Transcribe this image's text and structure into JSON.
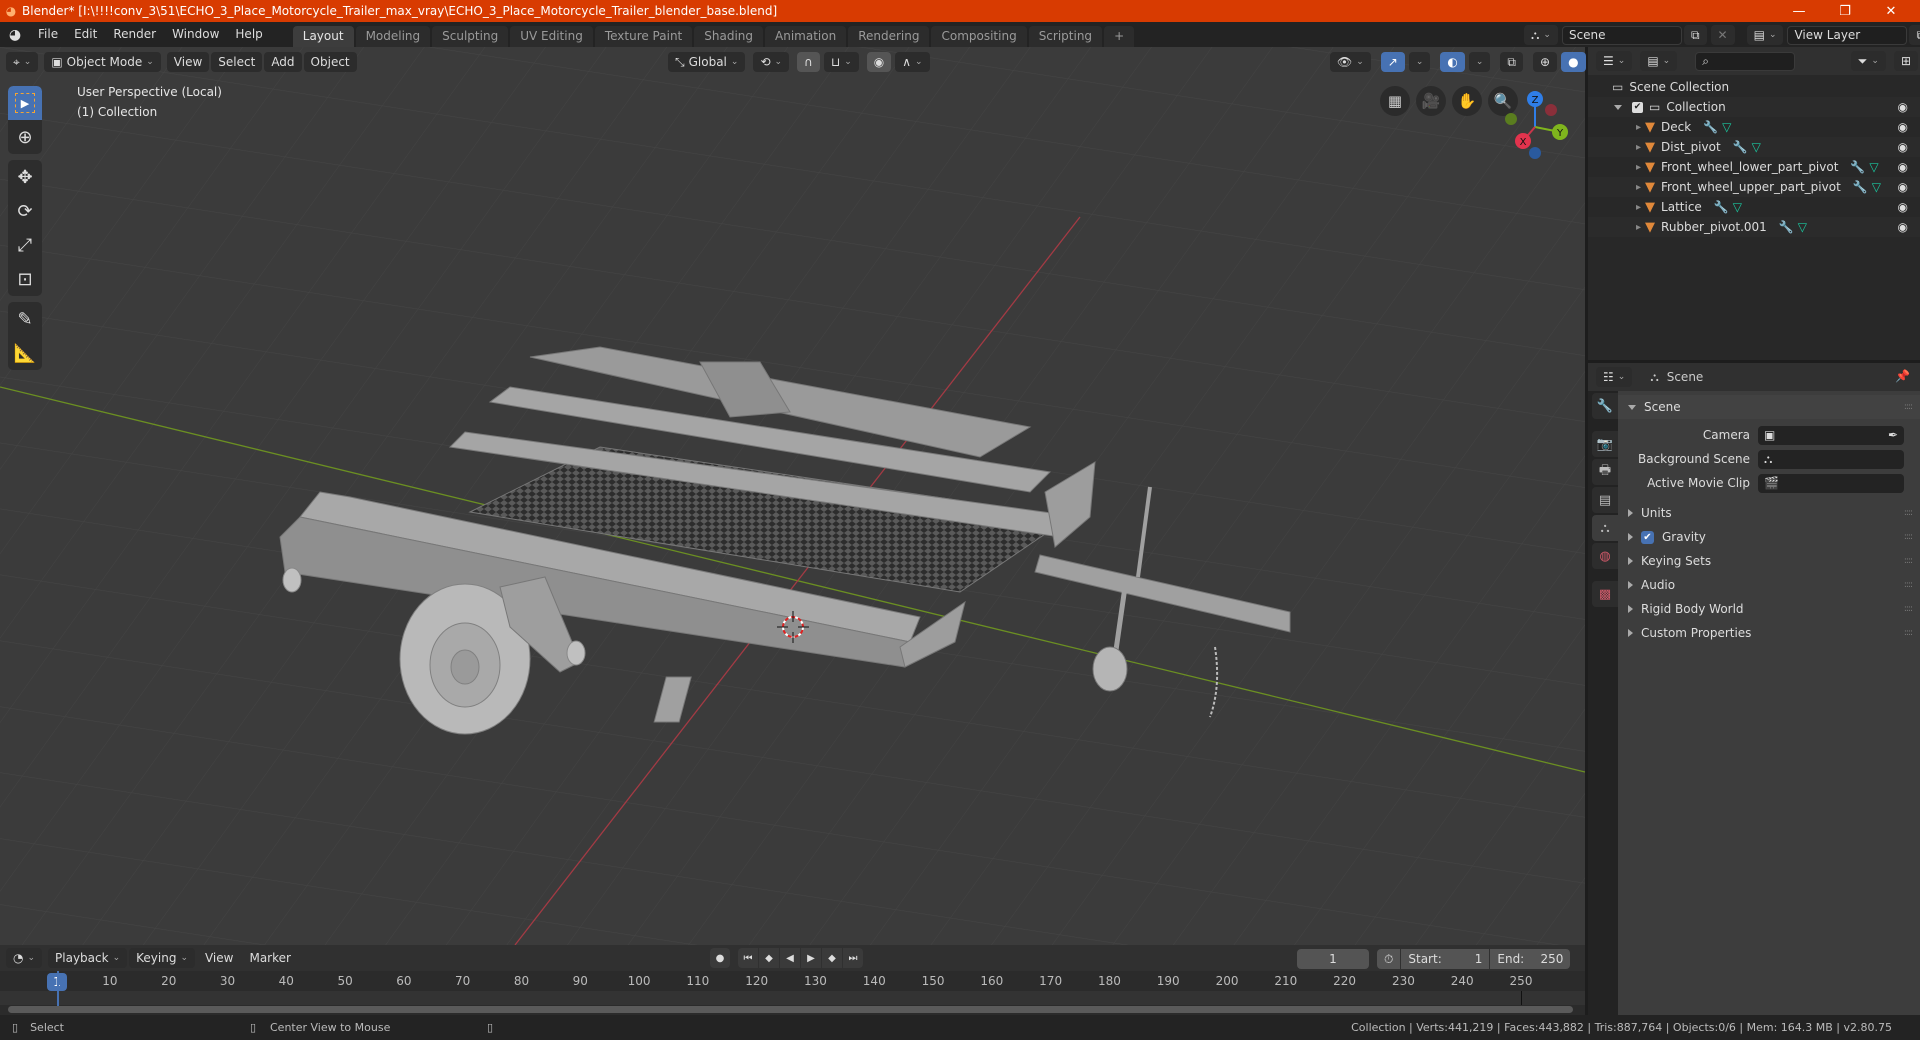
{
  "window": {
    "title": "Blender* [I:\\!!!!conv_3\\51\\ECHO_3_Place_Motorcycle_Trailer_max_vray\\ECHO_3_Place_Motorcycle_Trailer_blender_base.blend]",
    "controls": {
      "minimize": "—",
      "maximize": "❐",
      "close": "✕"
    }
  },
  "menubar": {
    "items": [
      "File",
      "Edit",
      "Render",
      "Window",
      "Help"
    ]
  },
  "workspaces": {
    "tabs": [
      "Layout",
      "Modeling",
      "Sculpting",
      "UV Editing",
      "Texture Paint",
      "Shading",
      "Animation",
      "Rendering",
      "Compositing",
      "Scripting"
    ],
    "active": "Layout",
    "add_label": "+"
  },
  "scene_selector": {
    "value": "Scene"
  },
  "view_layer_selector": {
    "value": "View Layer"
  },
  "viewport": {
    "mode": "Object Mode",
    "menus": [
      "View",
      "Select",
      "Add",
      "Object"
    ],
    "orientation": "Global",
    "overlay_text": {
      "view_name": "User Perspective (Local)",
      "collection": "(1) Collection"
    },
    "gizmo_axes": {
      "x": "X",
      "y": "Y",
      "z": "Z"
    },
    "colors": {
      "x_axis": "#c8364a",
      "y_axis": "#7fb51d",
      "z_axis": "#2f7ee8",
      "accent": "#4772b3"
    }
  },
  "tools": [
    "select-box",
    "cursor",
    "move",
    "rotate",
    "scale",
    "transform",
    "annotate",
    "measure"
  ],
  "outliner": {
    "search_placeholder": "",
    "root": "Scene Collection",
    "collection": "Collection",
    "objects": [
      {
        "name": "Deck"
      },
      {
        "name": "Dist_pivot"
      },
      {
        "name": "Front_wheel_lower_part_pivot"
      },
      {
        "name": "Front_wheel_upper_part_pivot"
      },
      {
        "name": "Lattice"
      },
      {
        "name": "Rubber_pivot.001"
      }
    ]
  },
  "properties": {
    "context": "Scene",
    "panel_title": "Scene",
    "fields": [
      {
        "label": "Camera",
        "value": ""
      },
      {
        "label": "Background Scene",
        "value": ""
      },
      {
        "label": "Active Movie Clip",
        "value": ""
      }
    ],
    "subpanels": [
      "Units",
      "Gravity",
      "Keying Sets",
      "Audio",
      "Rigid Body World",
      "Custom Properties"
    ],
    "gravity_enabled": true
  },
  "timeline": {
    "menus": [
      "Playback",
      "Keying",
      "View",
      "Marker"
    ],
    "current_frame": "1",
    "start_label": "Start:",
    "start": "1",
    "end_label": "End:",
    "end": "250",
    "ticks": [
      "10",
      "20",
      "30",
      "40",
      "50",
      "60",
      "70",
      "80",
      "90",
      "100",
      "110",
      "120",
      "130",
      "140",
      "150",
      "160",
      "170",
      "180",
      "190",
      "200",
      "210",
      "220",
      "230",
      "240",
      "250"
    ],
    "frame_indicator": "1"
  },
  "statusbar": {
    "left_hint": "Select",
    "middle_hint": "Center View to Mouse",
    "stats": "Collection | Verts:441,219 | Faces:443,882 | Tris:887,764 | Objects:0/6 | Mem: 164.3 MB | v2.80.75"
  }
}
